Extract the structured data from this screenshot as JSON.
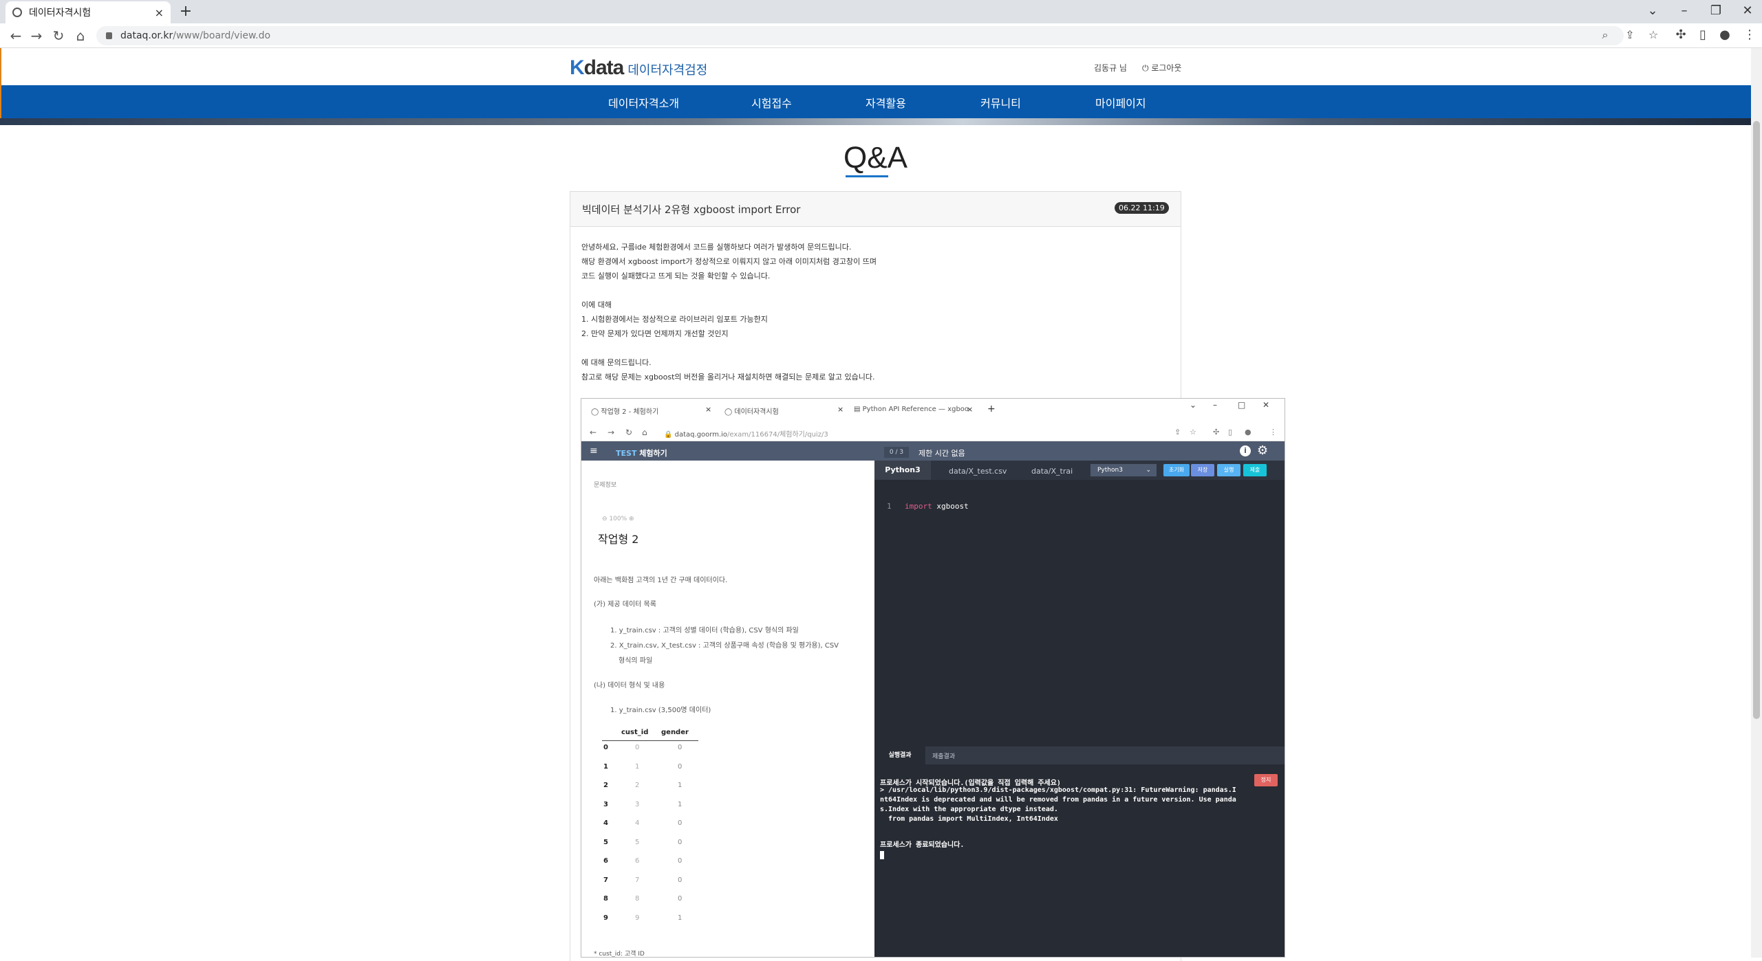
{
  "browser": {
    "tab_title": "데이터자격시험",
    "url_host": "dataq.or.kr",
    "url_path": "/www/board/view.do",
    "new_tab": "+",
    "close": "×"
  },
  "site": {
    "logo_k": "K",
    "logo_data": "data",
    "logo_sub": "데이터자격검정",
    "user": "김동규 님",
    "logout": "로그아웃",
    "nav": [
      "데이터자격소개",
      "시험접수",
      "자격활용",
      "커뮤니티",
      "마이페이지"
    ],
    "page_title": "Q&A"
  },
  "post": {
    "title": "빅데이터 분석기사 2유형 xgboost import Error",
    "date": "06.22 11:19",
    "lines": [
      "안녕하세요, 구름ide 체험환경에서 코드를 실행하보다 여러가 발생하여 문의드립니다.",
      "해당 환경에서 xgboost import가 정상적으로 이뤄지지 않고 아래 이미지처럼 경고창이 뜨며",
      "코드 실행이 실패했다고 뜨게 되는 것을 확인할 수 있습니다.",
      "이에 대해",
      "1. 시험환경에서는 정상적으로 라이브러리 임포트 가능한지",
      "2. 만약 문제가 있다면 언제까지 개선할 것인지",
      "에 대해 문의드립니다.",
      "참고로 해당 문제는 xgboost의 버전을 올리거나 재설치하면 해결되는 문제로 알고 있습니다."
    ]
  },
  "screenshot": {
    "tabs": [
      "작업형 2 - 체험하기",
      "데이터자격시험",
      "Python API Reference — xgboo"
    ],
    "url": "dataq.goorm.io/exam/116674/체험하기/quiz/3",
    "url_host": "dataq.goorm.io",
    "url_rest": "/exam/116674/체험하기/quiz/3",
    "app_test": "TEST",
    "app_title": "체험하기",
    "progress": "0 / 3",
    "time": "제한 시간 없음",
    "left": {
      "info": "문제정보",
      "zoom": "100%",
      "heading": "작업형 2",
      "intro": "아래는 백화점 고객의 1년 간 구매 데이터이다.",
      "section_ga": "(가) 제공 데이터 목록",
      "item1": "1. y_train.csv : 고객의 성별 데이터 (학습용), CSV 형식의 파일",
      "item2": "2. X_train.csv, X_test.csv : 고객의 상품구매 속성 (학습용 및 평가용), CSV",
      "item2b": "형식의 파일",
      "section_na": "(나) 데이터 형식 및 내용",
      "item3": "1. y_train.csv (3,500명 데이터)",
      "col1": "cust_id",
      "col2": "gender",
      "rows": [
        [
          "0",
          "0",
          "0"
        ],
        [
          "1",
          "1",
          "0"
        ],
        [
          "2",
          "2",
          "1"
        ],
        [
          "3",
          "3",
          "1"
        ],
        [
          "4",
          "4",
          "0"
        ],
        [
          "5",
          "5",
          "0"
        ],
        [
          "6",
          "6",
          "0"
        ],
        [
          "7",
          "7",
          "0"
        ],
        [
          "8",
          "8",
          "0"
        ],
        [
          "9",
          "9",
          "1"
        ]
      ],
      "footnote": "* cust_id: 고객 ID"
    },
    "editor": {
      "tabs": [
        "Python3",
        "data/X_test.csv",
        "data/X_trai"
      ],
      "lang": "Python3",
      "buttons": [
        "초기화",
        "저장",
        "실행",
        "제출"
      ],
      "line_no": "1",
      "code_kw": "import",
      "code_rest": " xgboost"
    },
    "output": {
      "tabs": [
        "실행결과",
        "제출결과"
      ],
      "stop": "정지",
      "lines": [
        "프로세스가 시작되었습니다.(입력값을 직접 입력해 주세요)",
        "> /usr/local/lib/python3.9/dist-packages/xgboost/compat.py:31: FutureWarning: pandas.I",
        "nt64Index is deprecated and will be removed from pandas in a future version. Use panda",
        "s.Index with the appropriate dtype instead.",
        "  from pandas import MultiIndex, Int64Index",
        "",
        "프로세스가 종료되었습니다."
      ]
    }
  }
}
